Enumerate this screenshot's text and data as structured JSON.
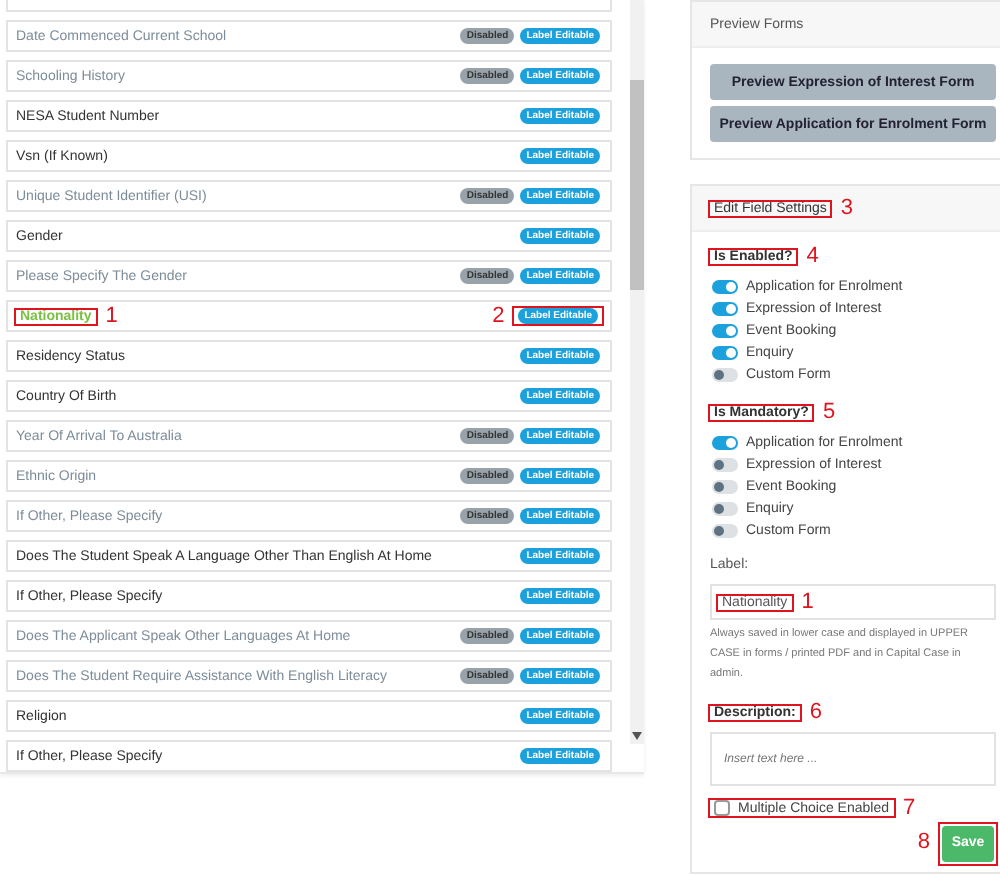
{
  "field_list": {
    "rows": [
      {
        "label": "Date Commenced Current School",
        "disabled": true,
        "selected": false,
        "badges": [
          {
            "kind": "disabled",
            "text": "Disabled"
          },
          {
            "kind": "editable",
            "text": "Label Editable"
          }
        ]
      },
      {
        "label": "Schooling History",
        "disabled": true,
        "selected": false,
        "badges": [
          {
            "kind": "disabled",
            "text": "Disabled"
          },
          {
            "kind": "editable",
            "text": "Label Editable"
          }
        ]
      },
      {
        "label": "NESA Student Number",
        "disabled": false,
        "selected": false,
        "badges": [
          {
            "kind": "editable",
            "text": "Label Editable"
          }
        ]
      },
      {
        "label": "Vsn (If Known)",
        "disabled": false,
        "selected": false,
        "badges": [
          {
            "kind": "editable",
            "text": "Label Editable"
          }
        ]
      },
      {
        "label": "Unique Student Identifier (USI)",
        "disabled": true,
        "selected": false,
        "badges": [
          {
            "kind": "disabled",
            "text": "Disabled"
          },
          {
            "kind": "editable",
            "text": "Label Editable"
          }
        ]
      },
      {
        "label": "Gender",
        "disabled": false,
        "selected": false,
        "badges": [
          {
            "kind": "editable",
            "text": "Label Editable"
          }
        ]
      },
      {
        "label": "Please Specify The Gender",
        "disabled": true,
        "selected": false,
        "badges": [
          {
            "kind": "disabled",
            "text": "Disabled"
          },
          {
            "kind": "editable",
            "text": "Label Editable"
          }
        ]
      },
      {
        "label": "Nationality",
        "disabled": false,
        "selected": true,
        "label_callout": "1",
        "badge_callout": "2",
        "badges": [
          {
            "kind": "editable",
            "text": "Label Editable"
          }
        ]
      },
      {
        "label": "Residency Status",
        "disabled": false,
        "selected": false,
        "badges": [
          {
            "kind": "editable",
            "text": "Label Editable"
          }
        ]
      },
      {
        "label": "Country Of Birth",
        "disabled": false,
        "selected": false,
        "badges": [
          {
            "kind": "editable",
            "text": "Label Editable"
          }
        ]
      },
      {
        "label": "Year Of Arrival To Australia",
        "disabled": true,
        "selected": false,
        "badges": [
          {
            "kind": "disabled",
            "text": "Disabled"
          },
          {
            "kind": "editable",
            "text": "Label Editable"
          }
        ]
      },
      {
        "label": "Ethnic Origin",
        "disabled": true,
        "selected": false,
        "badges": [
          {
            "kind": "disabled",
            "text": "Disabled"
          },
          {
            "kind": "editable",
            "text": "Label Editable"
          }
        ]
      },
      {
        "label": "If Other, Please Specify",
        "disabled": true,
        "selected": false,
        "badges": [
          {
            "kind": "disabled",
            "text": "Disabled"
          },
          {
            "kind": "editable",
            "text": "Label Editable"
          }
        ]
      },
      {
        "label": "Does The Student Speak A Language Other Than English At Home",
        "disabled": false,
        "selected": false,
        "badges": [
          {
            "kind": "editable",
            "text": "Label Editable"
          }
        ]
      },
      {
        "label": "If Other, Please Specify",
        "disabled": false,
        "selected": false,
        "badges": [
          {
            "kind": "editable",
            "text": "Label Editable"
          }
        ]
      },
      {
        "label": "Does The Applicant Speak Other Languages At Home",
        "disabled": true,
        "selected": false,
        "badges": [
          {
            "kind": "disabled",
            "text": "Disabled"
          },
          {
            "kind": "editable",
            "text": "Label Editable"
          }
        ]
      },
      {
        "label": "Does The Student Require Assistance With English Literacy",
        "disabled": true,
        "selected": false,
        "badges": [
          {
            "kind": "disabled",
            "text": "Disabled"
          },
          {
            "kind": "editable",
            "text": "Label Editable"
          }
        ]
      },
      {
        "label": "Religion",
        "disabled": false,
        "selected": false,
        "badges": [
          {
            "kind": "editable",
            "text": "Label Editable"
          }
        ]
      },
      {
        "label": "If Other, Please Specify",
        "disabled": false,
        "selected": false,
        "badges": [
          {
            "kind": "editable",
            "text": "Label Editable"
          }
        ]
      }
    ]
  },
  "preview": {
    "title": "Preview Forms",
    "buttons": [
      "Preview Expression of Interest Form",
      "Preview Application for Enrolment Form"
    ]
  },
  "settings": {
    "title": "Edit Field Settings",
    "title_callout": "3",
    "groups": [
      {
        "title": "Is Enabled?",
        "callout": "4",
        "toggles": [
          {
            "label": "Application for Enrolment",
            "on": true
          },
          {
            "label": "Expression of Interest",
            "on": true
          },
          {
            "label": "Event Booking",
            "on": true
          },
          {
            "label": "Enquiry",
            "on": true
          },
          {
            "label": "Custom Form",
            "on": false
          }
        ]
      },
      {
        "title": "Is Mandatory?",
        "callout": "5",
        "toggles": [
          {
            "label": "Application for Enrolment",
            "on": true
          },
          {
            "label": "Expression of Interest",
            "on": false
          },
          {
            "label": "Event Booking",
            "on": false
          },
          {
            "label": "Enquiry",
            "on": false
          },
          {
            "label": "Custom Form",
            "on": false
          }
        ]
      }
    ],
    "label_field": {
      "label": "Label:",
      "value": "Nationality",
      "callout": "1",
      "help": "Always saved in lower case and displayed in UPPER CASE in forms / printed PDF and in Capital Case in admin."
    },
    "description": {
      "label": "Description:",
      "callout": "6",
      "placeholder": "Insert text here ..."
    },
    "multiple_choice": {
      "label": "Multiple Choice Enabled",
      "checked": false,
      "callout": "7"
    },
    "save": {
      "text": "Save",
      "callout": "8"
    }
  }
}
